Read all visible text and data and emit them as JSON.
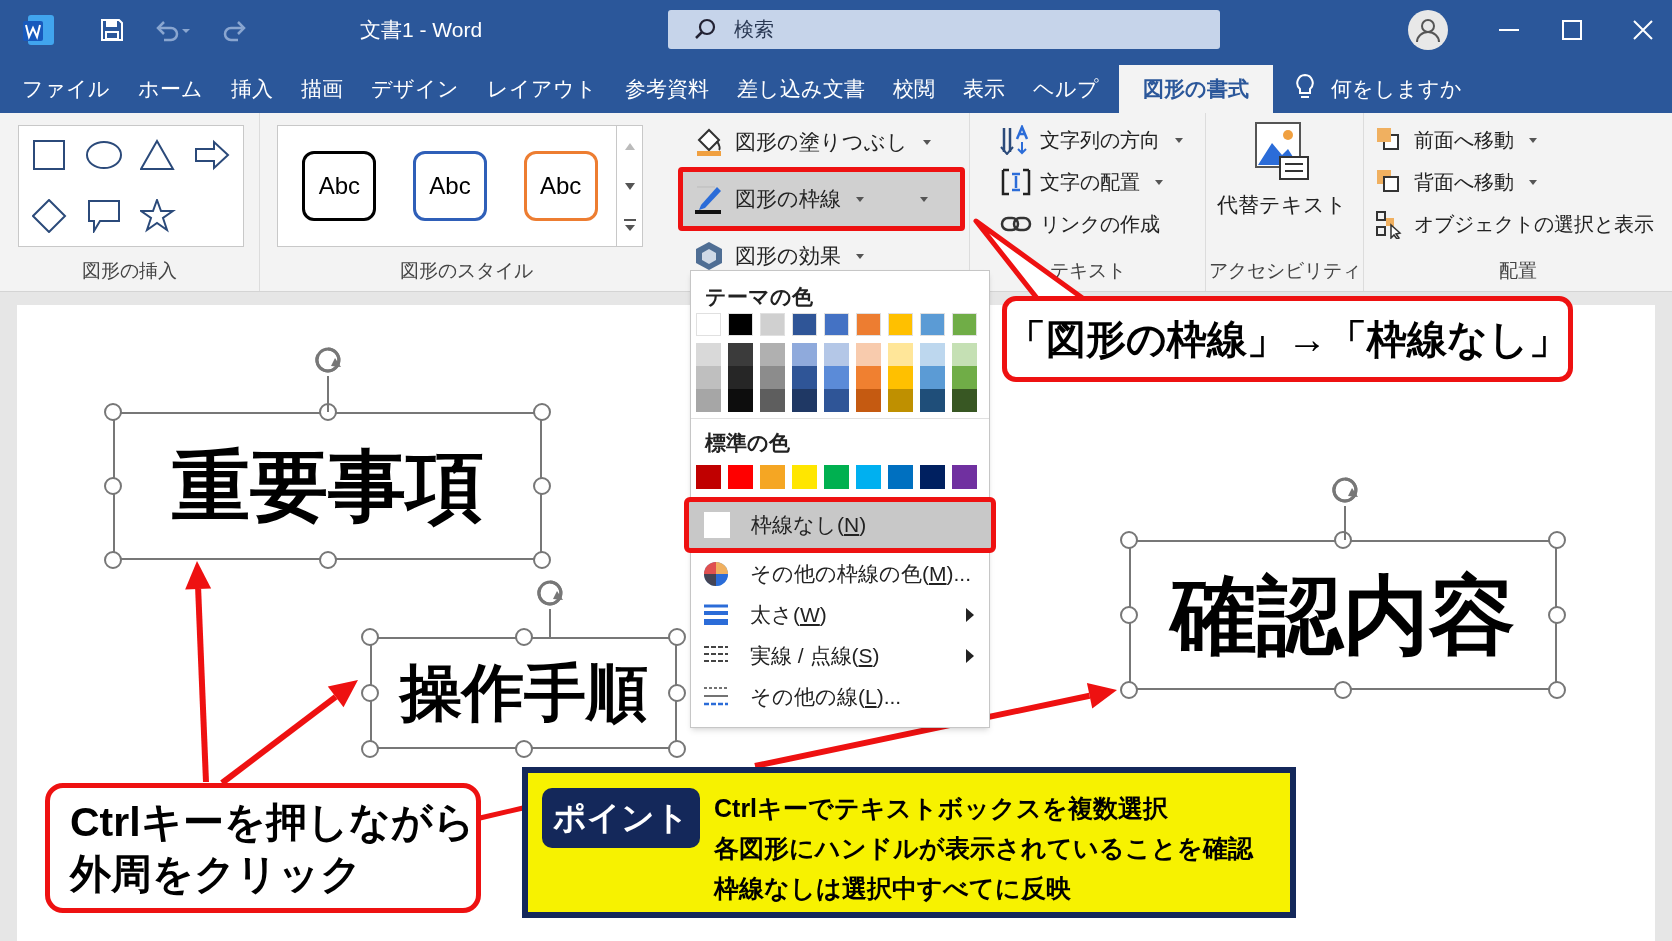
{
  "window": {
    "title": "文書1 - Word"
  },
  "search": {
    "placeholder": "検索"
  },
  "tabs": [
    {
      "label": "ファイル",
      "selected": false
    },
    {
      "label": "ホーム",
      "selected": false
    },
    {
      "label": "挿入",
      "selected": false
    },
    {
      "label": "描画",
      "selected": false
    },
    {
      "label": "デザイン",
      "selected": false
    },
    {
      "label": "レイアウト",
      "selected": false
    },
    {
      "label": "参考資料",
      "selected": false
    },
    {
      "label": "差し込み文書",
      "selected": false
    },
    {
      "label": "校閲",
      "selected": false
    },
    {
      "label": "表示",
      "selected": false
    },
    {
      "label": "ヘルプ",
      "selected": false
    },
    {
      "label": "図形の書式",
      "selected": true
    }
  ],
  "tell_me": {
    "label": "何をしますか"
  },
  "ribbon": {
    "shape_insert": {
      "label": "図形の挿入"
    },
    "shape_styles": {
      "samples": [
        {
          "text": "Abc",
          "color": "#000000"
        },
        {
          "text": "Abc",
          "color": "#2f5fb8"
        },
        {
          "text": "Abc",
          "color": "#ed7d31"
        }
      ],
      "label": "図形のスタイル"
    },
    "format_commands": [
      {
        "kind": "fill",
        "label": "図形の塗りつぶし",
        "highlighted": false,
        "split": false
      },
      {
        "kind": "outline",
        "label": "図形の枠線",
        "highlighted": true,
        "split": true
      },
      {
        "kind": "effects",
        "label": "図形の効果",
        "highlighted": false,
        "split": false
      }
    ],
    "text": {
      "commands": [
        {
          "kind": "direction",
          "label": "文字列の方向",
          "dropdown": true
        },
        {
          "kind": "align",
          "label": "文字の配置",
          "dropdown": true
        },
        {
          "kind": "link",
          "label": "リンクの作成",
          "dropdown": false
        }
      ],
      "label": "テキスト"
    },
    "accessibility": {
      "button": "代替テキスト",
      "label": "アクセシビリティ"
    },
    "arrange": {
      "commands": [
        {
          "kind": "forward",
          "label": "前面へ移動",
          "dropdown": true
        },
        {
          "kind": "backward",
          "label": "背面へ移動",
          "dropdown": true
        },
        {
          "kind": "selection",
          "label": "オブジェクトの選択と表示",
          "dropdown": false
        }
      ],
      "label": "配置"
    }
  },
  "outline_menu": {
    "theme_heading": "テーマの色",
    "theme_colors": [
      {
        "color": "#ffffff",
        "shades": [
          {
            "color": "#d9d9d9"
          },
          {
            "color": "#bfbfbf"
          },
          {
            "color": "#a6a6a6"
          }
        ]
      },
      {
        "color": "#000000",
        "shades": [
          {
            "color": "#3b3b3b"
          },
          {
            "color": "#262626"
          },
          {
            "color": "#0d0d0d"
          }
        ]
      },
      {
        "color": "#d0d0d0",
        "shades": [
          {
            "color": "#b0b0b0"
          },
          {
            "color": "#8c8c8c"
          },
          {
            "color": "#5e5e5e"
          }
        ]
      },
      {
        "color": "#2f5597",
        "shades": [
          {
            "color": "#8faadc"
          },
          {
            "color": "#2f5597"
          },
          {
            "color": "#1f3864"
          }
        ]
      },
      {
        "color": "#4472c4",
        "shades": [
          {
            "color": "#b4c7e7"
          },
          {
            "color": "#5b8bd8"
          },
          {
            "color": "#2f5597"
          }
        ]
      },
      {
        "color": "#ed7d31",
        "shades": [
          {
            "color": "#f8cbad"
          },
          {
            "color": "#f08030"
          },
          {
            "color": "#c55a11"
          }
        ]
      },
      {
        "color": "#ffc000",
        "shades": [
          {
            "color": "#ffe699"
          },
          {
            "color": "#ffc000"
          },
          {
            "color": "#bf9000"
          }
        ]
      },
      {
        "color": "#5b9bd5",
        "shades": [
          {
            "color": "#bdd7ee"
          },
          {
            "color": "#5b9bd5"
          },
          {
            "color": "#1f4e79"
          }
        ]
      },
      {
        "color": "#70ad47",
        "shades": [
          {
            "color": "#c5e0b4"
          },
          {
            "color": "#70ad47"
          },
          {
            "color": "#385723"
          }
        ]
      }
    ],
    "standard_heading": "標準の色",
    "standard_colors": [
      {
        "color": "#c00000"
      },
      {
        "color": "#ff0000"
      },
      {
        "color": "#f5a623"
      },
      {
        "color": "#ffe600"
      },
      {
        "color": "#00b050"
      },
      {
        "color": "#00b0f0"
      },
      {
        "color": "#0070c0"
      },
      {
        "color": "#002060"
      },
      {
        "color": "#7030a0"
      }
    ],
    "items": [
      {
        "kind": "none",
        "text_before": "枠線なし(",
        "access_key": "N",
        "text_after": ")",
        "highlighted": true,
        "submenu": false
      },
      {
        "kind": "more_colors",
        "text_before": "その他の枠線の色(",
        "access_key": "M",
        "text_after": ")...",
        "highlighted": false,
        "submenu": false
      },
      {
        "kind": "weight",
        "text_before": "太さ(",
        "access_key": "W",
        "text_after": ")",
        "highlighted": false,
        "submenu": true
      },
      {
        "kind": "dashes",
        "text_before": "実線 / 点線(",
        "access_key": "S",
        "text_after": ")",
        "highlighted": false,
        "submenu": true
      },
      {
        "kind": "more_lines",
        "text_before": "その他の線(",
        "access_key": "L",
        "text_after": ")...",
        "highlighted": false,
        "submenu": false
      }
    ]
  },
  "text_boxes": [
    {
      "text": "重要事項",
      "selected": true
    },
    {
      "text": "操作手順",
      "selected": true
    },
    {
      "text": "確認内容",
      "selected": true
    }
  ],
  "callouts": [
    {
      "text": "「図形の枠線」→「枠線なし」"
    },
    {
      "text": "Ctrlキーを押しながら外周をクリック"
    }
  ],
  "point_box": {
    "badge": "ポイント",
    "lines": [
      "Ctrlキーでテキストボックスを複数選択",
      "各図形にハンドルが表示されていることを確認",
      "枠線なしは選択中すべてに反映"
    ]
  }
}
